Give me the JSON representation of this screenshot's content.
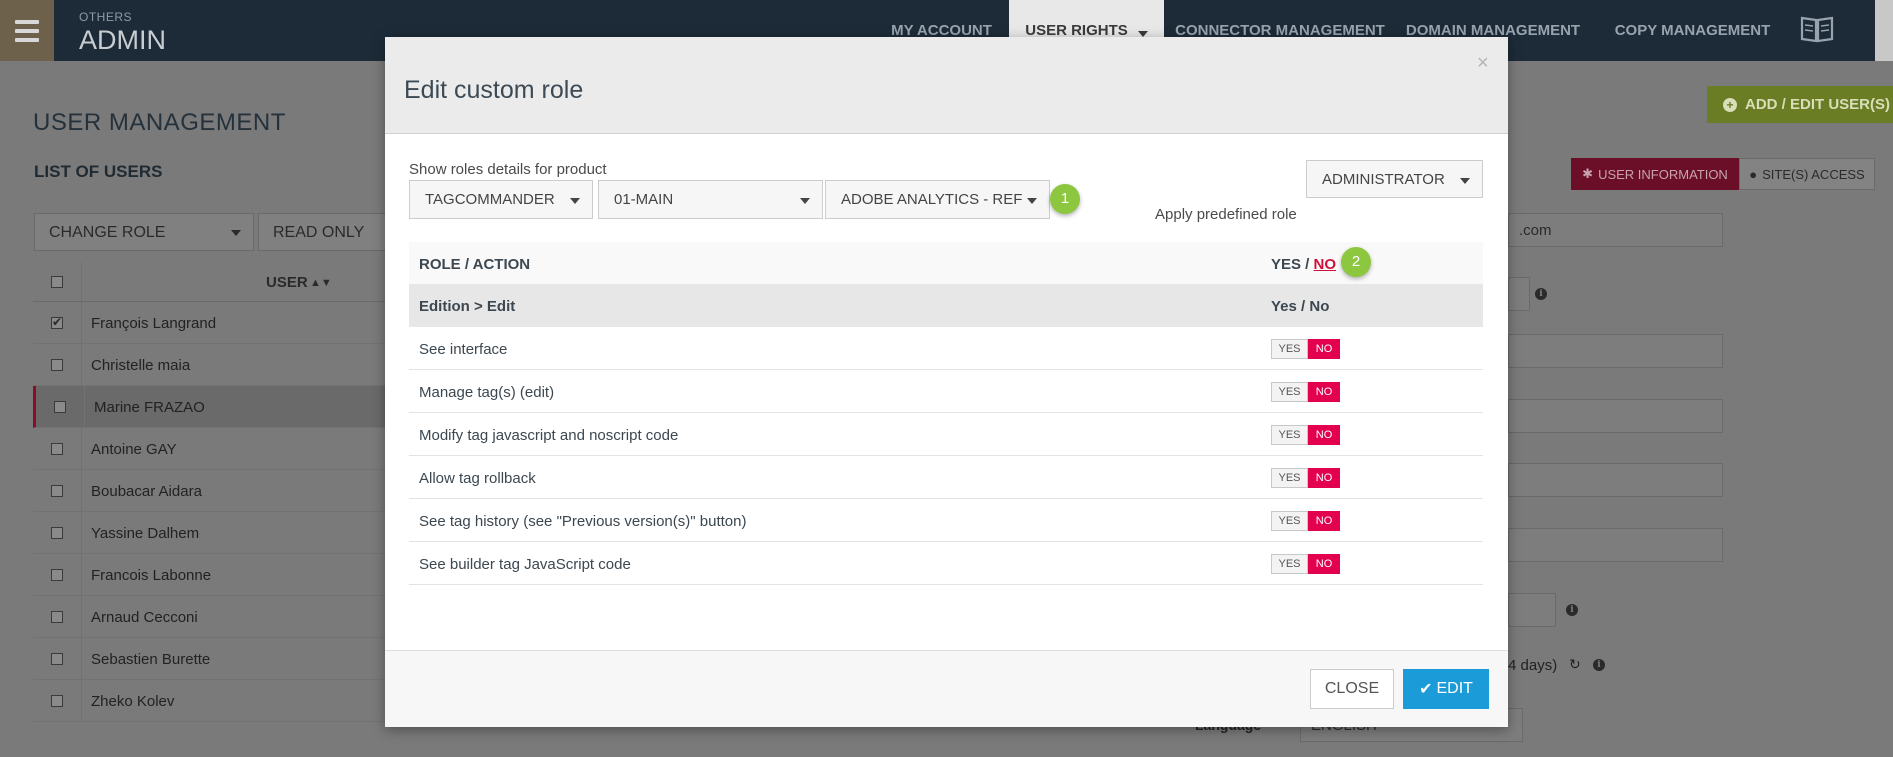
{
  "header": {
    "section": "OTHERS",
    "app_title": "ADMIN",
    "nav": [
      "MY ACCOUNT",
      "USER RIGHTS",
      "CONNECTOR MANAGEMENT",
      "DOMAIN MANAGEMENT",
      "COPY MANAGEMENT"
    ],
    "active_nav": "USER RIGHTS"
  },
  "page": {
    "title": "USER MANAGEMENT",
    "list_title": "LIST OF USERS",
    "change_role_select": "CHANGE ROLE",
    "read_only_select": "READ ONLY",
    "user_column": "USER",
    "users": [
      {
        "name": "François Langrand",
        "checked": true,
        "selected": false
      },
      {
        "name": "Christelle maia",
        "checked": false,
        "selected": false
      },
      {
        "name": "Marine FRAZAO",
        "checked": false,
        "selected": true
      },
      {
        "name": "Antoine GAY",
        "checked": false,
        "selected": false
      },
      {
        "name": "Boubacar Aidara",
        "checked": false,
        "selected": false
      },
      {
        "name": "Yassine Dalhem",
        "checked": false,
        "selected": false
      },
      {
        "name": "Francois Labonne",
        "checked": false,
        "selected": false
      },
      {
        "name": "Arnaud Cecconi",
        "checked": false,
        "selected": false
      },
      {
        "name": "Sebastien Burette",
        "checked": false,
        "selected": false
      },
      {
        "name": "Zheko Kolev",
        "checked": false,
        "selected": false
      }
    ],
    "add_edit_button": "ADD / EDIT USER(S)",
    "tabs": [
      "USER INFORMATION",
      "SITE(S) ACCESS"
    ],
    "email_fragment": ".com",
    "days_fragment": "4 days)",
    "language_label": "Language",
    "language_value": "ENGLISH"
  },
  "modal": {
    "title": "Edit custom role",
    "close_x": "×",
    "product_label": "Show roles details for product",
    "product_select": "TAGCOMMANDER",
    "site_select": "01-MAIN",
    "tag_select": "ADOBE ANALYTICS - REF",
    "predefined_label": "Apply predefined role",
    "predefined_select": "ADMINISTRATOR",
    "badge_1": "1",
    "badge_2": "2",
    "table": {
      "col_role": "ROLE / ACTION",
      "col_yes": "YES /",
      "col_no": "NO",
      "group": "Edition > Edit",
      "group_value": "Yes / No",
      "rows": [
        "See interface",
        "Manage tag(s) (edit)",
        "Modify tag javascript and noscript code",
        "Allow tag rollback",
        "See tag history (see \"Previous version(s)\" button)",
        "See builder tag JavaScript code"
      ],
      "toggle_yes": "YES",
      "toggle_no": "NO"
    },
    "close_button": "CLOSE",
    "edit_button": "EDIT"
  },
  "colors": {
    "topbar": "#1d2b38",
    "toggle_no": "#e3004f",
    "edit_button": "#1b9bd8",
    "badge": "#8dc63f"
  }
}
